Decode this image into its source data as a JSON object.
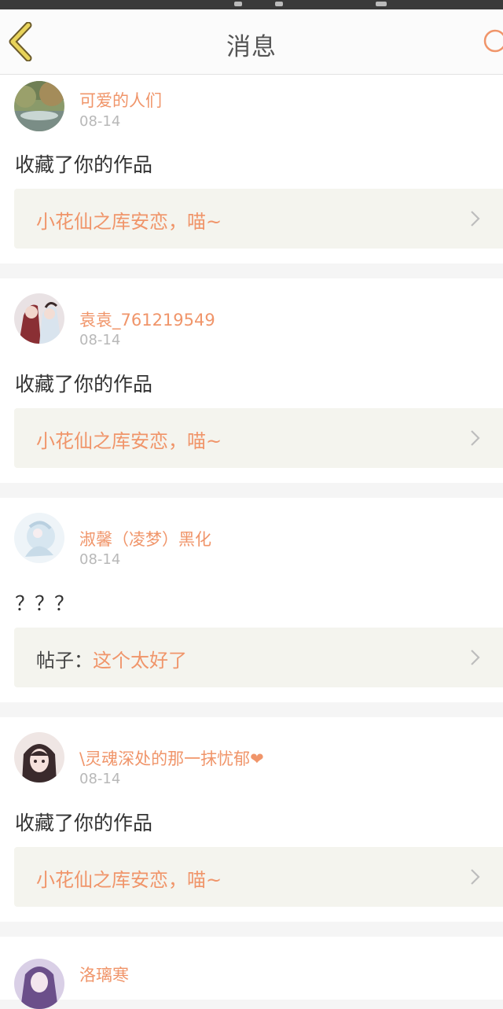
{
  "header": {
    "title": "消息"
  },
  "messages": [
    {
      "username": "可爱的人们",
      "date": "08-14",
      "action": "收藏了你的作品",
      "ref_prefix": "",
      "ref_title": "小花仙之库安恋，喵~"
    },
    {
      "username": "袁袁_761219549",
      "date": "08-14",
      "action": "收藏了你的作品",
      "ref_prefix": "",
      "ref_title": "小花仙之库安恋，喵~"
    },
    {
      "username": "淑馨（凌梦）黑化",
      "date": "08-14",
      "action": "？？？",
      "ref_prefix": "帖子：",
      "ref_title": "这个太好了"
    },
    {
      "username": "\\灵魂深处的那一抹忧郁❤",
      "date": "08-14",
      "action": "收藏了你的作品",
      "ref_prefix": "",
      "ref_title": "小花仙之库安恋，喵~"
    },
    {
      "username": "洛璃寒"
    }
  ],
  "colors": {
    "accent": "#f0956a",
    "back_arrow": "#e8d35a",
    "background": "#f5f5f5"
  },
  "icons": {
    "back": "back-arrow-icon",
    "refresh": "refresh-icon",
    "chevron": "chevron-right-icon"
  }
}
